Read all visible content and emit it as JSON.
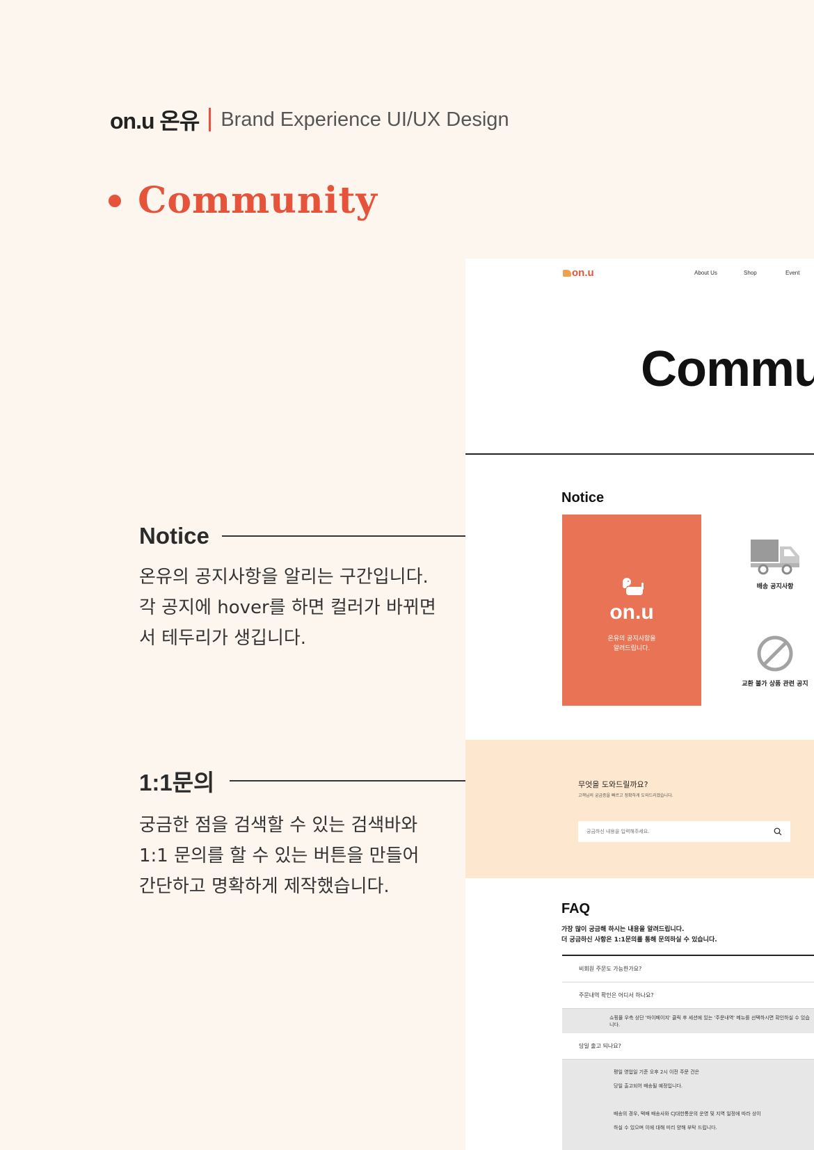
{
  "header": {
    "brand_name": "on.u 온유",
    "brand_sub": "Brand Experience UI/UX Design"
  },
  "section": {
    "title": "Community"
  },
  "callouts": [
    {
      "title": "Notice",
      "desc": "온유의 공지사항을 알리는 구간입니다. 각 공지에 hover를 하면 컬러가 바뀌면서 테두리가 생깁니다."
    },
    {
      "title": "1:1문의",
      "desc": "궁금한 점을 검색할 수 있는 검색바와 1:1 문의를 할 수 있는 버튼을 만들어 간단하고 명확하게 제작했습니다."
    }
  ],
  "mockup": {
    "logo": "on.u",
    "nav": [
      "About Us",
      "Shop",
      "Event"
    ],
    "hero_title": "Community",
    "notice": {
      "label": "Notice",
      "card_logo": "on.u",
      "card_text": "온유의 공지사항을\n알려드립니다.",
      "items": [
        {
          "icon": "truck-icon",
          "label": "배송 공지사항"
        },
        {
          "icon": "prohibited-icon",
          "label": "교환 불가 상품 관련 공지"
        }
      ]
    },
    "inquiry": {
      "title": "무엇을 도와드릴까요?",
      "subtitle": "고객님의 궁금증을 빠르고 정확하게 도와드리겠습니다.",
      "search_placeholder": "궁금하신 내용을 입력해주세요."
    },
    "faq": {
      "title": "FAQ",
      "desc_line1": "가장 많이 궁금해 하시는 내용을 알려드립니다.",
      "desc_line2": "더 궁금하신 사항은 1:1문의를 통해 문의하실 수 있습니다.",
      "q1": "비회원 주문도 가능한가요?",
      "q2": "주문내역 확인은 어디서 하나요?",
      "a2": "쇼핑몰 우측 상단 '마이페이지' 클릭 후 세션에 있는 '주문내역' 메뉴를 선택하시면 확인하실 수 있습니다.",
      "q3": "당일 출고 되나요?",
      "a3": [
        "평일 영업일 기준 오후 2시 이전 주문 건은",
        "당일 출고되어 배송될 예정입니다.",
        "",
        "배송의 경우, 택배 배송사와 CJ대한통운의 운영 및 지역 일정에 따라 상이",
        "하실 수 있으며 이에 대해 미리 양해 부탁 드립니다."
      ]
    }
  }
}
